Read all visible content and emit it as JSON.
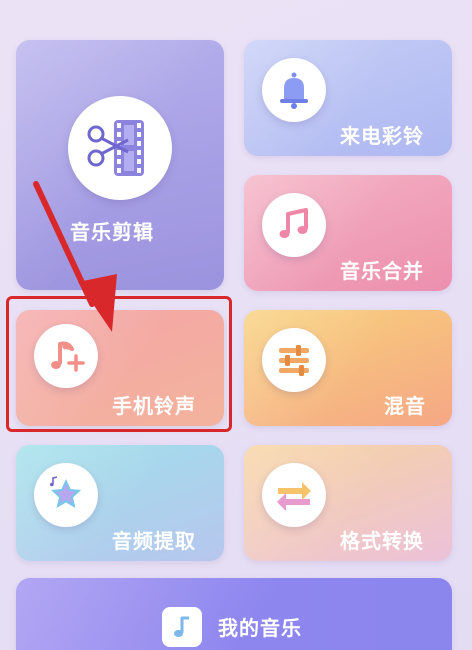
{
  "cards": {
    "music_edit": {
      "label": "音乐剪辑",
      "icon": "scissors-film-icon"
    },
    "ringtone_call": {
      "label": "来电彩铃",
      "icon": "bell-icon"
    },
    "music_merge": {
      "label": "音乐合并",
      "icon": "music-note-icon"
    },
    "phone_ringtone": {
      "label": "手机铃声",
      "icon": "music-note-plus-icon"
    },
    "mix": {
      "label": "混音",
      "icon": "equalizer-icon"
    },
    "audio_extract": {
      "label": "音频提取",
      "icon": "star-music-icon"
    },
    "format_convert": {
      "label": "格式转换",
      "icon": "swap-arrows-icon"
    },
    "my_music": {
      "label": "我的音乐",
      "icon": "music-note-icon"
    }
  },
  "colors": {
    "annotation_red": "#d9282b",
    "music_edit_bg": "#a59de4",
    "ringtone_call_bg": "#aeb8f1",
    "music_merge_bg": "#ec8fae",
    "phone_ringtone_bg": "#f4a8a2",
    "mix_bg": "#f6bd80",
    "audio_extract_bg": "#a9d6ec",
    "format_convert_bg": "#f2cab9",
    "my_music_bg": "#8e86ef"
  }
}
